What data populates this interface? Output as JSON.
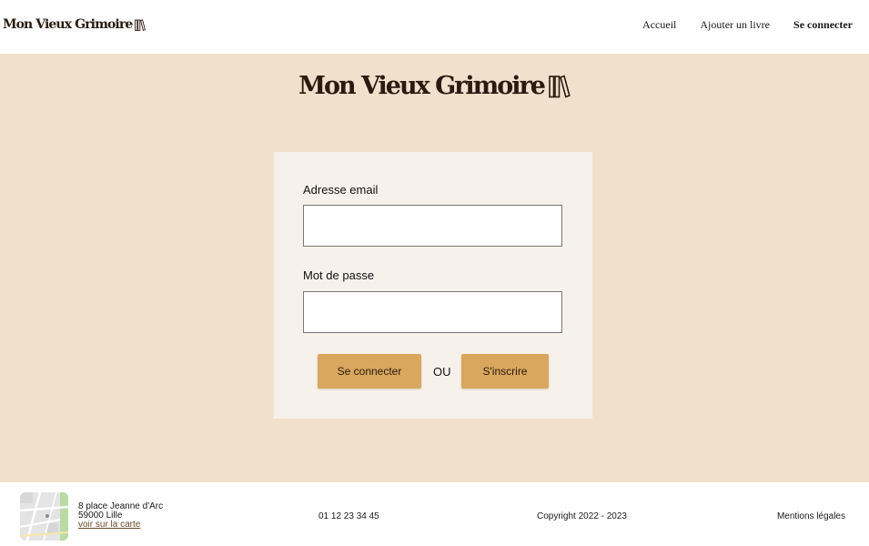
{
  "header": {
    "logo_text": "Mon Vieux Grimoire",
    "nav": [
      {
        "label": "Accueil"
      },
      {
        "label": "Ajouter un livre"
      },
      {
        "label": "Se connecter"
      }
    ]
  },
  "main": {
    "logo_text": "Mon Vieux Grimoire",
    "form": {
      "email_label": "Adresse email",
      "email_value": "",
      "password_label": "Mot de passe",
      "password_value": "",
      "login_button": "Se connecter",
      "or_text": "OU",
      "signup_button": "S'inscrire"
    }
  },
  "footer": {
    "address_line1": "8 place Jeanne d'Arc",
    "address_line2": "59000 Lille",
    "map_link": "voir sur la carte",
    "phone": "01 12 23 34 45",
    "copyright": "Copyright 2022 - 2023",
    "legal": "Mentions légales"
  },
  "colors": {
    "background_main": "#f1e1cc",
    "card_background": "#f7f1ec",
    "button": "#d9a75d",
    "logo_text": "#2a1a10"
  },
  "icons": {
    "logo_icon": "books-icon",
    "map_thumbnail": "map-icon"
  }
}
